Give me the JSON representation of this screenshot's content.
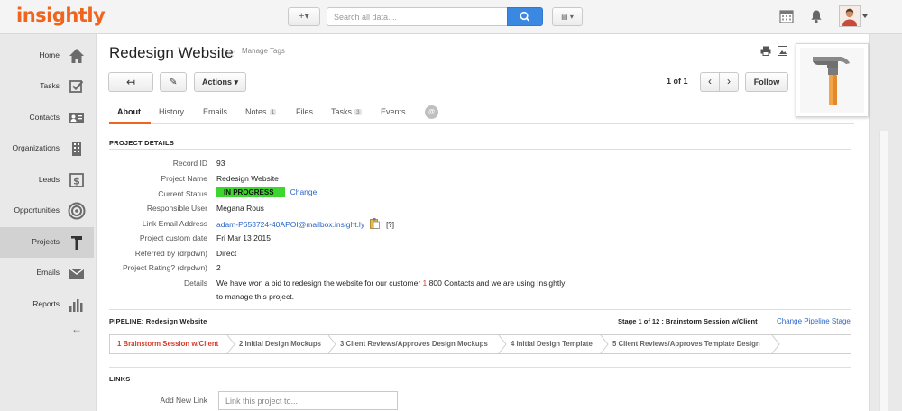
{
  "app": {
    "logo": "insightly"
  },
  "topbar": {
    "add_label": "+▾",
    "search_placeholder": "Search all data....",
    "view_label": "▤ ▾"
  },
  "sidebar": {
    "items": [
      {
        "label": "Home",
        "icon": "home-icon"
      },
      {
        "label": "Tasks",
        "icon": "tasks-icon"
      },
      {
        "label": "Contacts",
        "icon": "contacts-icon"
      },
      {
        "label": "Organizations",
        "icon": "organizations-icon"
      },
      {
        "label": "Leads",
        "icon": "leads-icon"
      },
      {
        "label": "Opportunities",
        "icon": "opportunities-icon"
      },
      {
        "label": "Projects",
        "icon": "projects-icon"
      },
      {
        "label": "Emails",
        "icon": "emails-icon"
      },
      {
        "label": "Reports",
        "icon": "reports-icon"
      }
    ],
    "active": "Projects",
    "collapse_label": "←"
  },
  "record": {
    "title": "Redesign Website",
    "star": "☆",
    "manage_tags": "Manage Tags",
    "back_label": "↤",
    "edit_label": "✎",
    "actions_label": "Actions ▾",
    "pager": "1 of 1",
    "prev_label": "‹",
    "next_label": "›",
    "follow_label": "Follow"
  },
  "tabs": [
    {
      "label": "About",
      "count": ""
    },
    {
      "label": "History",
      "count": ""
    },
    {
      "label": "Emails",
      "count": ""
    },
    {
      "label": "Notes",
      "count": "1"
    },
    {
      "label": "Files",
      "count": ""
    },
    {
      "label": "Tasks",
      "count": "3"
    },
    {
      "label": "Events",
      "count": ""
    }
  ],
  "tab_chat": "@",
  "details": {
    "heading": "PROJECT DETAILS",
    "fields": [
      {
        "label": "Record ID",
        "value": "93"
      },
      {
        "label": "Project Name",
        "value": "Redesign Website"
      },
      {
        "label": "Current Status",
        "value": "IN PROGRESS",
        "action": "Change"
      },
      {
        "label": "Responsible User",
        "value": "Megana Rous"
      },
      {
        "label": "Link Email Address",
        "value": "adam-P653724-40APOI@mailbox.insight.ly",
        "help": "[?]"
      },
      {
        "label": "Project custom date",
        "value": "Fri Mar 13 2015"
      },
      {
        "label": "Referred by (drpdwn)",
        "value": "Direct"
      },
      {
        "label": "Project Rating? (drpdwn)",
        "value": "2"
      },
      {
        "label": "Details",
        "value_line1_pre": "We have won a bid to redesign the website for our customer ",
        "value_line1_num": "1",
        "value_line1_post": " 800 Contacts and we are using Insightly",
        "value_line2": "to manage this project."
      }
    ],
    "status_color": "#3dd62e"
  },
  "pipeline": {
    "heading": "PIPELINE:",
    "name": "Redesign Website",
    "stage_info": "Stage 1 of 12 : Brainstorm Session w/Client",
    "change_link": "Change Pipeline Stage",
    "stages": [
      "1 Brainstorm Session w/Client",
      "2 Initial Design Mockups",
      "3 Client Reviews/Approves Design Mockups",
      "4 Initial Design Template",
      "5 Client Reviews/Approves Template Design"
    ]
  },
  "links": {
    "heading": "LINKS",
    "add_label": "Add New Link",
    "input_placeholder": "Link this project to..."
  },
  "colors": {
    "brand": "#f0641e",
    "link": "#2a66c6",
    "search_button": "#3b88e3"
  }
}
